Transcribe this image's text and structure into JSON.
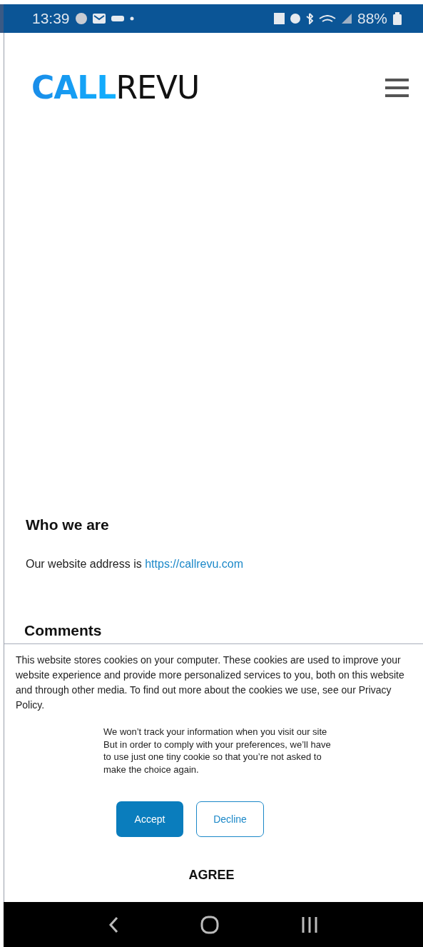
{
  "status_bar": {
    "time": "13:39",
    "battery": "88%"
  },
  "header": {
    "logo": {
      "first": "CALL",
      "second": "REVU"
    }
  },
  "content": {
    "heading": "Who we are",
    "address_text": "Our website address is ",
    "address_link": "https://callrevu.com",
    "next_heading": "Comments"
  },
  "cookie_banner": {
    "message": "This website stores cookies on your computer. These cookies are used to improve your website experience and provide more personalized services to you, both on this website and through other media. To find out more about the cookies we use, see our Privacy Policy.",
    "decline_note": [
      "We won’t track your information when you visit our site",
      "But in order to comply with your preferences, we’ll have",
      "to use just one tiny cookie so that you’re not asked to",
      "make the choice again."
    ],
    "buttons": [
      {
        "label": "Accept",
        "kind": "primary"
      },
      {
        "label": "Decline",
        "kind": "outline"
      }
    ],
    "agree": "AGREE"
  }
}
